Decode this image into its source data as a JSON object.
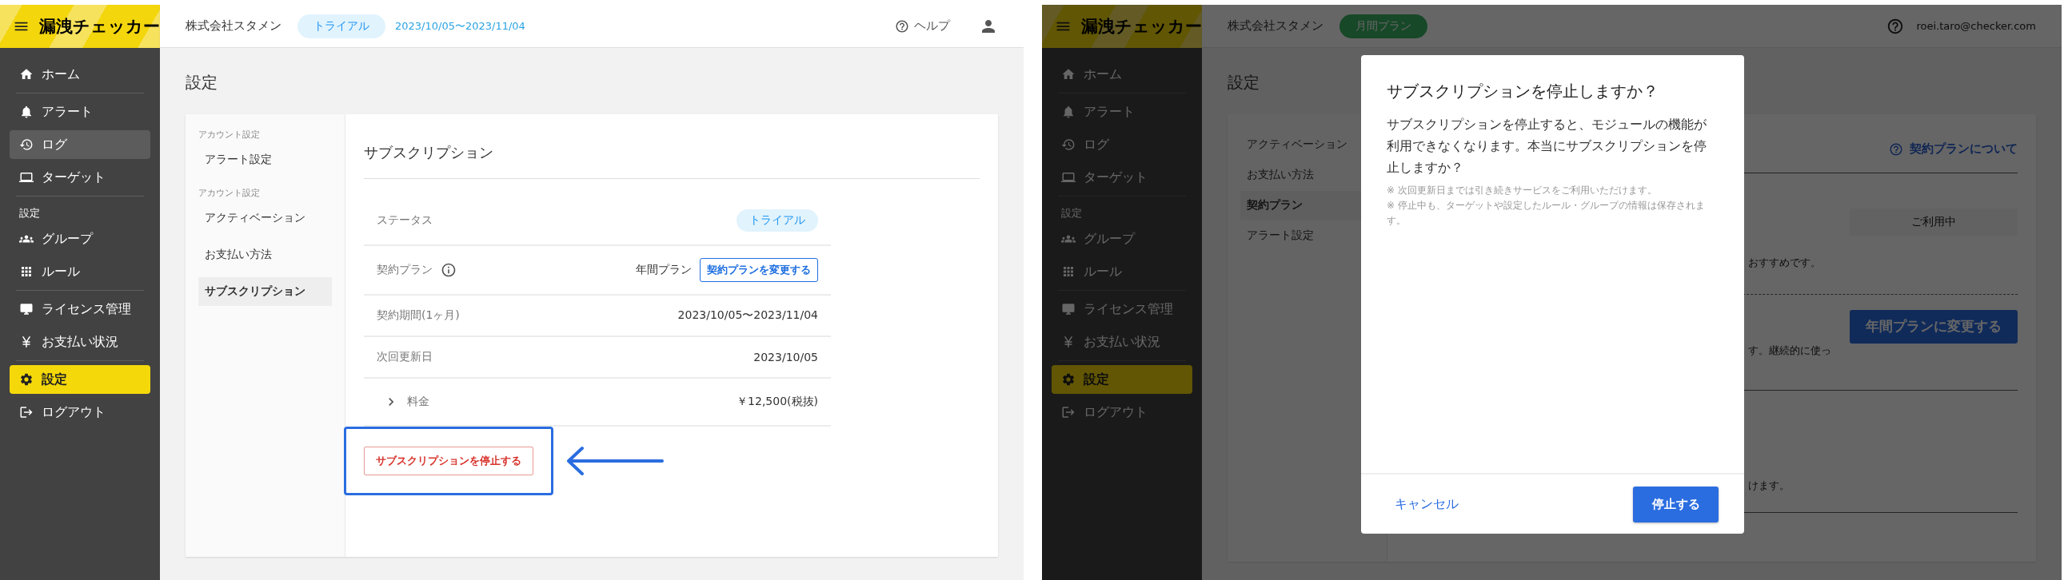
{
  "settings_screen": {
    "app_name": "漏洩チェッカー",
    "header": {
      "company": "株式会社スタメン",
      "plan_badge": "トライアル",
      "period": "2023/10/05〜2023/11/04",
      "help": "ヘルプ"
    },
    "sidebar": {
      "groups": [
        {
          "items": [
            {
              "label": "ホーム",
              "selected": false,
              "hovered": false
            }
          ]
        },
        {
          "items": [
            {
              "label": "アラート",
              "selected": false,
              "hovered": false
            },
            {
              "label": "ログ",
              "selected": false,
              "hovered": true
            },
            {
              "label": "ターゲット",
              "selected": false,
              "hovered": false
            }
          ]
        },
        {
          "heading": "設定",
          "items": [
            {
              "label": "グループ",
              "selected": false,
              "hovered": false
            },
            {
              "label": "ルール",
              "selected": false,
              "hovered": false
            }
          ]
        },
        {
          "items": [
            {
              "label": "ライセンス管理",
              "selected": false,
              "hovered": false
            },
            {
              "label": "お支払い状況",
              "selected": false,
              "hovered": false
            }
          ]
        },
        {
          "items": [
            {
              "label": "設定",
              "selected": true,
              "hovered": false
            },
            {
              "label": "ログアウト",
              "selected": false,
              "hovered": false
            }
          ]
        }
      ]
    },
    "page_title": "設定",
    "settings_nav": {
      "groups": [
        {
          "heading": "アカウント設定",
          "items": [
            {
              "label": "アラート設定",
              "selected": false
            }
          ]
        },
        {
          "heading": "アカウント設定",
          "items": [
            {
              "label": "アクティベーション",
              "selected": false
            },
            {
              "label": "お支払い方法",
              "selected": false
            },
            {
              "label": "サブスクリプション",
              "selected": true
            }
          ]
        }
      ]
    },
    "panel": {
      "title": "サブスクリプション",
      "rows": [
        {
          "kind": "badge",
          "label": "ステータス",
          "value": "トライアル"
        },
        {
          "kind": "plan",
          "label": "契約プラン",
          "value": "年間プラン",
          "action": "契約プランを変更する"
        },
        {
          "kind": "text",
          "label": "契約期間(1ヶ月)",
          "value": "2023/10/05〜2023/11/04"
        },
        {
          "kind": "text",
          "label": "次回更新日",
          "value": "2023/10/05"
        },
        {
          "kind": "expandable",
          "label": "料金",
          "value": "￥12,500(税抜)",
          "expanded": false
        }
      ],
      "stop_button": "サブスクリプションを停止する",
      "stop_button_highlighted": true
    }
  },
  "confirm_screen": {
    "app_name": "漏洩チェッカー",
    "header": {
      "company": "株式会社スタメン",
      "plan_badge": "月間プラン",
      "account": "roei.taro@checker.com"
    },
    "sidebar": {
      "groups": [
        {
          "items": [
            {
              "label": "ホーム",
              "selected": false
            }
          ]
        },
        {
          "items": [
            {
              "label": "アラート",
              "selected": false
            },
            {
              "label": "ログ",
              "selected": false
            },
            {
              "label": "ターゲット",
              "selected": false
            }
          ]
        },
        {
          "heading": "設定",
          "items": [
            {
              "label": "グループ",
              "selected": false
            },
            {
              "label": "ルール",
              "selected": false
            }
          ]
        },
        {
          "items": [
            {
              "label": "ライセンス管理",
              "selected": false
            },
            {
              "label": "お支払い状況",
              "selected": false
            }
          ]
        },
        {
          "items": [
            {
              "label": "設定",
              "selected": true
            },
            {
              "label": "ログアウト",
              "selected": false
            }
          ]
        }
      ]
    },
    "page_title": "設定",
    "settings_nav": {
      "groups": [
        {
          "items": [
            {
              "label": "アクティベーション",
              "selected": false
            },
            {
              "label": "お支払い方法",
              "selected": false
            },
            {
              "label": "契約プラン",
              "selected": true
            },
            {
              "label": "アラート設定",
              "selected": false
            }
          ]
        }
      ]
    },
    "panel": {
      "link": "契約プランについて",
      "plans": [
        {
          "kind": "current",
          "note": "おすすめです。",
          "status": "ご利用中"
        },
        {
          "kind": "upgrade",
          "note": "す。継続的に使っ",
          "action": "年間プランに変更する"
        }
      ],
      "footnote": "けます。"
    },
    "dialog": {
      "title": "サブスクリプションを停止しますか？",
      "message": "サブスクリプションを停止すると、モジュールの機能が利用できなくなります。本当にサブスクリプションを停止しますか？",
      "notes": [
        "※ 次回更新日までは引き続きサービスをご利用いただけます。",
        "※ 停止中も、ターゲットや設定したルール・グループの情報は保存されます。"
      ],
      "cancel": "キャンセル",
      "confirm": "停止する"
    }
  }
}
